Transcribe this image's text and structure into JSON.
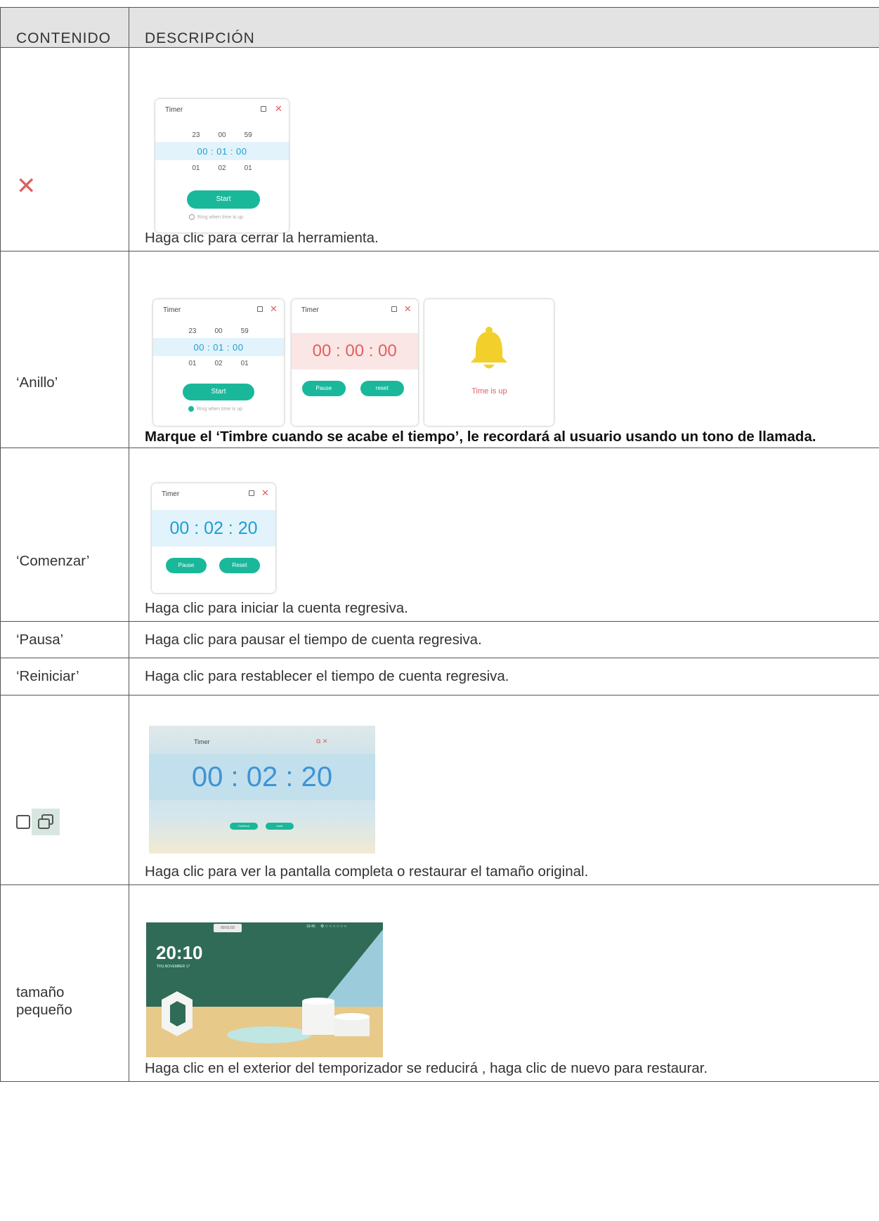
{
  "header": {
    "col1": "CONTENIDO",
    "col2": "DESCRIPCIÓN"
  },
  "rows": [
    {
      "label": "",
      "description": "Haga clic para cerrar la herramienta.",
      "icon": "close-x-icon"
    },
    {
      "label": "‘Anillo’",
      "description": "Marque el ‘Timbre cuando se acabe el tiempo’, le recordará al usuario usando un tono de llamada."
    },
    {
      "label": "‘Comenzar’",
      "description": "Haga clic para iniciar la cuenta regresiva."
    },
    {
      "label": "‘Pausa’",
      "description": "Haga clic para pausar el tiempo de cuenta regresiva."
    },
    {
      "label": "‘Reiniciar’",
      "description": "Haga clic para restablecer el tiempo de cuenta regresiva."
    },
    {
      "label": "",
      "description": "Haga clic para ver la pantalla completa o restaurar el tamaño original.",
      "icons": [
        "maximize-icon",
        "restore-icon"
      ]
    },
    {
      "label": "tamaño pequeño",
      "description": "Haga clic en el exterior del temporizador se reducirá , haga clic de nuevo para restaurar."
    }
  ],
  "timer": {
    "title": "Timer",
    "above": [
      "23",
      "00",
      "59"
    ],
    "selected": "00  :  01  :  00",
    "below": [
      "01",
      "02",
      "01"
    ],
    "start": "Start",
    "ring_label": "Ring when time is up",
    "running_red": "00 : 00 : 00",
    "pause": "Pause",
    "reset_lower": "reset",
    "reset": "Reset",
    "time_is_up": "Time is up",
    "running_blue": "00 : 02 : 20",
    "fullscreen_time": "00 : 02 : 20",
    "fullscreen_btn1": "Continue",
    "fullscreen_btn2": "reset"
  },
  "desktop": {
    "clock": "20:10",
    "date": "THU,NOVEMBER 17",
    "mini_timer": "00:01:03",
    "status_time": "16:45"
  },
  "colors": {
    "accent_green": "#1ab89a",
    "blue_digits": "#1a9fd3",
    "red_digits": "#e06060",
    "bell": "#f2cf2a",
    "close_red": "#d9625f"
  }
}
